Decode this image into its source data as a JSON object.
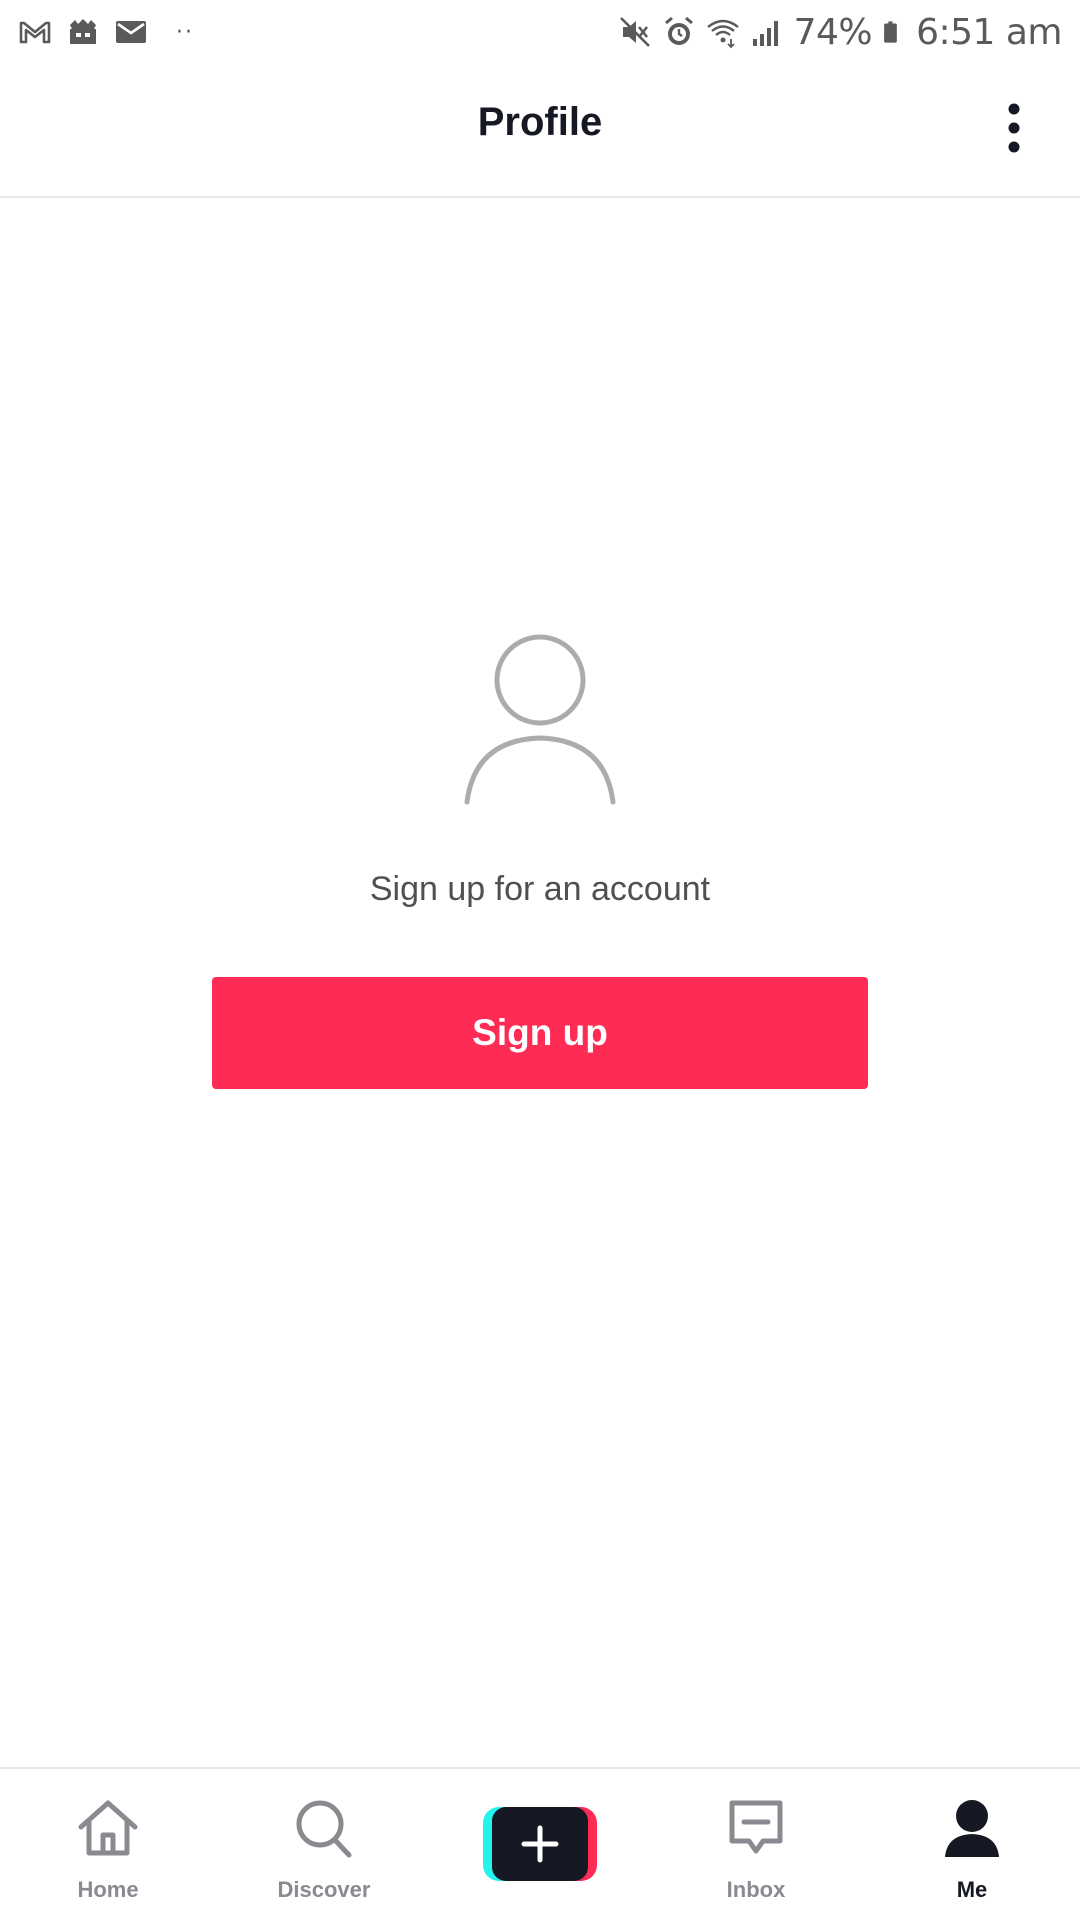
{
  "status_bar": {
    "left_icons": [
      "gmail-icon",
      "game-icon",
      "mail-icon",
      "more-notifications-dots"
    ],
    "dots": "··",
    "right_icons": [
      "mute-icon",
      "alarm-icon",
      "wifi-icon",
      "signal-icon",
      "battery-icon"
    ],
    "battery_percent": "74%",
    "time": "6:51 am"
  },
  "header": {
    "title": "Profile",
    "menu_icon": "more-vertical-icon"
  },
  "main": {
    "avatar_icon": "user-placeholder-icon",
    "prompt": "Sign up for an account",
    "signup_label": "Sign up"
  },
  "bottom_nav": {
    "items": [
      {
        "label": "Home",
        "icon": "home-icon"
      },
      {
        "label": "Discover",
        "icon": "search-icon"
      },
      {
        "label": "",
        "icon": "plus-icon"
      },
      {
        "label": "Inbox",
        "icon": "inbox-icon"
      },
      {
        "label": "Me",
        "icon": "person-icon",
        "active": true
      }
    ]
  },
  "colors": {
    "accent": "#fe2c55",
    "cyan": "#25f4ee",
    "dark": "#161823",
    "inactive": "#8a8b91"
  }
}
